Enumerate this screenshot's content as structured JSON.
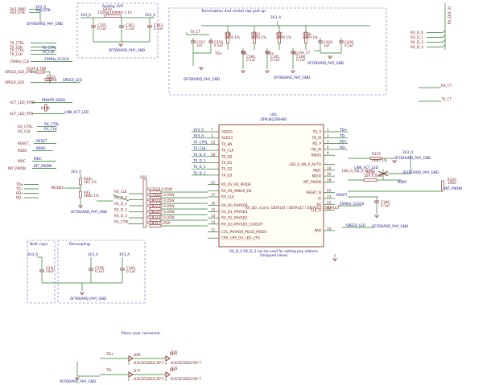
{
  "left_nets": {
    "power": [
      "3V3_PWR",
      "3V3_RTN",
      "3V3_0",
      "3V3_RTN"
    ],
    "power_ground": "OFFBOARD_PHY_GND",
    "tx_rows": [
      "TX_CTRL",
      "TX_CLK",
      "TX_CTRL",
      "TX_CLK"
    ],
    "phy_clk": "25MHz_CLK",
    "phy_clk_out": "25MHz_CLOCK",
    "led_rows": [
      "SPEED_LED_SYNC",
      "SPEED_LED"
    ],
    "led_parts": [
      "R329",
      "4.7KR",
      "R122",
      "1K RR"
    ],
    "act_rows": [
      "ACT_LED_SYNC",
      "ACT_LED_RTN"
    ],
    "act_parts": [
      "RMAPD VDDO",
      "R406",
      "1K RR"
    ],
    "link_led": "LINK_ACT_LED",
    "rx_rows": [
      "RX_CTRL",
      "RX_CLK",
      "RX_CTRL",
      "RX_CLK"
    ],
    "reset": [
      "RESET_",
      "RESET"
    ],
    "mdio": [
      "MDIO",
      "MDIO",
      "MDC",
      "MDC"
    ],
    "int": [
      "INT_PWDN",
      "INT_PWDN"
    ],
    "mode_block": {
      "v": "3V3_0",
      "r1": "R40n",
      "r1_val": "1K2 1%",
      "r2": "R43",
      "r2_val": "1K80 1%",
      "label": "MODE3",
      "pins": [
        "TD+",
        "TD-",
        "RD+",
        "RD-"
      ],
      "gnd": "OFFBOARD_PHY_GND"
    }
  },
  "analog": {
    "title": "Analog 3V3",
    "fb": "FB10",
    "fb_val": "120R@100MHz 1.1A",
    "v": "3V3_0",
    "net": "3V3_A",
    "caps": [
      [
        "C155",
        "0.1uF"
      ],
      [
        "C162",
        "2.2uF"
      ],
      [
        "C163",
        "0.1uF"
      ]
    ],
    "gnd": "OFFBOARD_PHY_GND"
  },
  "term": {
    "title": "Termination and center tap pull-up",
    "net": "3V3_A",
    "tx_ct": "TX_CT",
    "rx_ct": "RX_CT",
    "caps": [
      [
        "C417",
        "1uF"
      ],
      [
        "C418",
        "0.1uF"
      ],
      [
        "C419",
        "1uF"
      ],
      [
        "C420",
        "0.1uF"
      ],
      [
        "C164",
        "0.1uF"
      ],
      [
        "C165",
        "0.1uF"
      ],
      [
        "C168",
        "0.1uF"
      ]
    ],
    "res": [
      [
        "R38",
        "49R9 1%"
      ],
      [
        "R323",
        "49R9 1%"
      ],
      [
        "R37",
        "49R9 1%"
      ],
      [
        "R32b",
        "49R9 1%"
      ]
    ],
    "nodes": [
      "TD+",
      "TD-",
      "RD+",
      "RD-"
    ],
    "gnd": [
      "OFFBOARD_PHY_GND",
      "OFFBOARD_PHY_GND"
    ]
  },
  "right_bus": {
    "nets": [
      "RX_D_0",
      "RX_D_1",
      "RX_D_2",
      "RX_D_3"
    ],
    "bus": "RX_D[0..3]",
    "ct": [
      "RX_CT",
      "TX_CT"
    ]
  },
  "u41": {
    "ref": "U41",
    "part": "DP83822IRHBR",
    "left_pins": [
      [
        "VDDIO",
        "7"
      ],
      [
        "AVD33",
        "1"
      ],
      [
        "TX_EN",
        "25"
      ],
      [
        "TX_CLK",
        ""
      ],
      [
        "TX_D0",
        "28"
      ],
      [
        "TX_D1",
        ""
      ],
      [
        "TX_D2",
        ""
      ],
      [
        "TX_D3",
        ""
      ],
      [
        "RX_DV_RX_MODE",
        "21"
      ],
      [
        "RX_ER_AMDIX_EN",
        ""
      ],
      [
        "RX_CLK",
        "17"
      ],
      [
        "RX_D0_PHYAD0",
        "16"
      ],
      [
        "RX_D1_PHYAD1",
        "15"
      ],
      [
        "RX_D2_PHYAD2",
        "14"
      ],
      [
        "RX_D3_PHYAD3_CLKOUT",
        "13"
      ],
      [
        "COL_PHYAD0_MLED_MODE",
        "11"
      ],
      [
        "CRS_CRS_DV_LED_CFG",
        ""
      ]
    ],
    "right_pins": [
      [
        "TD_P",
        "1"
      ],
      [
        "TD_M",
        "2"
      ],
      [
        "RD_P",
        "3"
      ],
      [
        "RD_M",
        "4"
      ],
      [
        "RBIAS",
        "8"
      ],
      [
        "LED_0_AN_0_AUTO",
        ""
      ],
      [
        "MDC",
        "19"
      ],
      [
        "MDIO",
        "20"
      ],
      [
        "INT_PWDN",
        "18"
      ],
      [
        "RESET_N",
        "24"
      ],
      [
        "XI",
        "23"
      ],
      [
        "XO",
        "22"
      ],
      [
        "CLK_O",
        "33"
      ],
      [
        "PAD",
        "33"
      ]
    ],
    "in_nets": [
      "3V3_0",
      "3V3_A",
      "TX_CTRL",
      "TX_CLK",
      "TX_D_0",
      "TX_D_1",
      "TX_D_2",
      "TX_D_3"
    ],
    "out_nets": [
      "TD+",
      "TD-",
      "RD+",
      "RD-"
    ],
    "strap_note": "RX_D0..3 pins: DEFAULT / DEFAULT / DEFAULT / DEFAULT",
    "note1": "RX_D_0 RX_D_3 can be used for setting phy address",
    "note2": "(strapped value)"
  },
  "rx_block": {
    "u": "U83",
    "rx_nets": [
      "RX_CLK",
      "RX_D_0",
      "RX_D_1",
      "RX_D_2",
      "RX_D_3",
      "RX_CTRL"
    ],
    "res": [
      "R27620 0.05W",
      "R279220 0.05W",
      "R280220 0.05W",
      "R281220 0.05W",
      "R282220 0.05W",
      "R283220 0.05W",
      "R2822 0.05W"
    ]
  },
  "right_parts": {
    "r_rbias": [
      "R315",
      "4K87 1%"
    ],
    "v": "3V3_0",
    "r_mdio": [
      "R328",
      "22R 0.05W"
    ],
    "r_int": [
      "R320",
      "10K0"
    ],
    "c_reset": [
      "C186",
      "0.1uF"
    ],
    "led_net": "LED_0_AN_0_AUTO",
    "act_led": "LINK_ACT_LED",
    "mdio": "MDIO",
    "int_pwdn": "INT_PWDN",
    "reset": "RESET",
    "clk": "25MHz_CLOCK",
    "speed": "SPEED_LED",
    "gnd": [
      "OFFBOARD_PHY_GND",
      "OFFBOARD_PHY_GND",
      "OFFBOARD_PHY_GND"
    ]
  },
  "bulk": {
    "title": "Bulk caps",
    "v": "3V3_0",
    "cap": [
      "C15n",
      "10uF"
    ]
  },
  "decoupling": {
    "title": "Decoupling",
    "caps": [
      [
        "C156",
        "0.1uF"
      ],
      [
        "C164",
        "0.1uF"
      ]
    ],
    "v": [
      "3V3_0",
      "3V3_A"
    ],
    "gnd": "OFFBOARD_PHY_GND"
  },
  "connector": {
    "title": "Place near connector",
    "rows": [
      {
        "net": "TD+",
        "d1": "D69",
        "d1v": "D3V3Z1BD2CSP-7",
        "net2": "RD+",
        "d2": "D70",
        "d2v": "D3V3Z1BD2CSP-7"
      },
      {
        "net": "TD-",
        "d1": "D77",
        "d1v": "D3V3Z1BD2CSP-7",
        "net2": "RD-",
        "d2": "D78",
        "d2v": "D3V3Z1BD2CSP-7"
      }
    ],
    "gnd": "OFFBOARD_PHY_GND"
  }
}
